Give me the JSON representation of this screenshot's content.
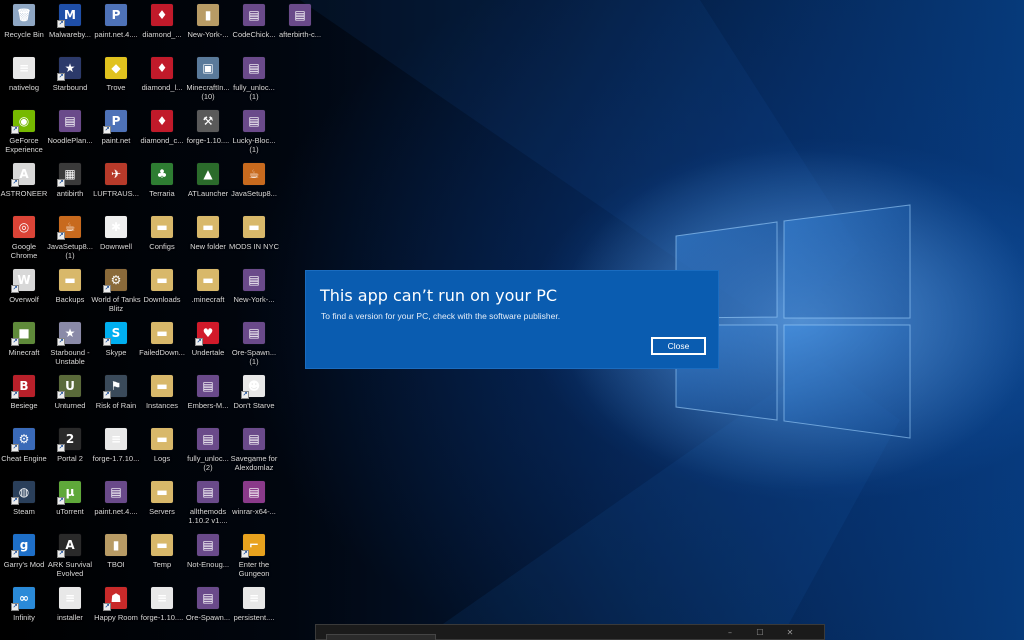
{
  "desktop": {
    "icons": [
      {
        "label": "Recycle Bin",
        "icon": "recycle-bin-icon",
        "color": "#8fa7c4",
        "glyph": "🗑",
        "shortcut": false
      },
      {
        "label": "Malwareby...",
        "icon": "malwarebytes-icon",
        "color": "#1f4fa8",
        "glyph": "M",
        "shortcut": true
      },
      {
        "label": "paint.net.4....",
        "icon": "paintnet-installer-icon",
        "color": "#4e72b8",
        "glyph": "P",
        "shortcut": false
      },
      {
        "label": "diamond_...",
        "icon": "diamond-app-icon",
        "color": "#c11a2a",
        "glyph": "♦",
        "shortcut": false
      },
      {
        "label": "New-York-...",
        "icon": "file-icon",
        "color": "#b89b65",
        "glyph": "▮",
        "shortcut": false
      },
      {
        "label": "CodeChick...",
        "icon": "winrar-archive-icon",
        "color": "#6a4a8a",
        "glyph": "▤",
        "shortcut": false
      },
      {
        "label": "afterbirth-c...",
        "icon": "winrar-archive-icon",
        "color": "#6a4a8a",
        "glyph": "▤",
        "shortcut": false
      },
      {
        "label": "nativelog",
        "icon": "text-file-icon",
        "color": "#e8e8e8",
        "glyph": "≡",
        "shortcut": false
      },
      {
        "label": "Starbound",
        "icon": "starbound-icon",
        "color": "#2c3a6a",
        "glyph": "★",
        "shortcut": true
      },
      {
        "label": "Trove",
        "icon": "trove-icon",
        "color": "#e0c21e",
        "glyph": "◆",
        "shortcut": false
      },
      {
        "label": "diamond_l...",
        "icon": "diamond-app-icon",
        "color": "#c11a2a",
        "glyph": "♦",
        "shortcut": false
      },
      {
        "label": "MinecraftIn... (10)",
        "icon": "minecraft-installer-icon",
        "color": "#5a7a9a",
        "glyph": "▣",
        "shortcut": false
      },
      {
        "label": "fully_unloc... (1)",
        "icon": "winrar-archive-icon",
        "color": "#6a4a8a",
        "glyph": "▤",
        "shortcut": false
      },
      {
        "label": "GeForce Experience",
        "icon": "geforce-icon",
        "color": "#76b900",
        "glyph": "◉",
        "shortcut": true
      },
      {
        "label": "NoodlePlan...",
        "icon": "winrar-archive-icon",
        "color": "#6a4a8a",
        "glyph": "▤",
        "shortcut": false
      },
      {
        "label": "paint.net",
        "icon": "paintnet-icon",
        "color": "#4e72b8",
        "glyph": "P",
        "shortcut": true
      },
      {
        "label": "diamond_c...",
        "icon": "diamond-app-icon",
        "color": "#c11a2a",
        "glyph": "♦",
        "shortcut": false
      },
      {
        "label": "forge-1.10....",
        "icon": "forge-icon",
        "color": "#5a5a5a",
        "glyph": "⚒",
        "shortcut": false
      },
      {
        "label": "Lucky-Bloc... (1)",
        "icon": "winrar-archive-icon",
        "color": "#6a4a8a",
        "glyph": "▤",
        "shortcut": false
      },
      {
        "label": "ASTRONEER",
        "icon": "astroneer-icon",
        "color": "#d8d8d8",
        "glyph": "A",
        "shortcut": true
      },
      {
        "label": "antibirth",
        "icon": "antibirth-icon",
        "color": "#3a3a3a",
        "glyph": "▦",
        "shortcut": true
      },
      {
        "label": "LUFTRAUS...",
        "icon": "luftrausers-icon",
        "color": "#b73a2a",
        "glyph": "✈",
        "shortcut": false
      },
      {
        "label": "Terraria",
        "icon": "terraria-icon",
        "color": "#2e7d32",
        "glyph": "♣",
        "shortcut": false
      },
      {
        "label": "ATLauncher",
        "icon": "atlauncher-icon",
        "color": "#2b6b2b",
        "glyph": "▲",
        "shortcut": false
      },
      {
        "label": "JavaSetup8...",
        "icon": "java-icon",
        "color": "#c86a1e",
        "glyph": "☕",
        "shortcut": false
      },
      {
        "label": "Google Chrome",
        "icon": "chrome-icon",
        "color": "#db4437",
        "glyph": "◎",
        "shortcut": false
      },
      {
        "label": "JavaSetup8... (1)",
        "icon": "java-icon",
        "color": "#c86a1e",
        "glyph": "☕",
        "shortcut": true
      },
      {
        "label": "Downwell",
        "icon": "downwell-icon",
        "color": "#efefef",
        "glyph": "✱",
        "shortcut": false
      },
      {
        "label": "Configs",
        "icon": "folder-icon",
        "color": "#d8b86a",
        "glyph": "▬",
        "shortcut": false
      },
      {
        "label": "New folder",
        "icon": "folder-icon",
        "color": "#d8b86a",
        "glyph": "▬",
        "shortcut": false
      },
      {
        "label": "MODS IN NYC",
        "icon": "folder-icon",
        "color": "#d8b86a",
        "glyph": "▬",
        "shortcut": false
      },
      {
        "label": "Overwolf",
        "icon": "overwolf-icon",
        "color": "#d8d8d8",
        "glyph": "W",
        "shortcut": true
      },
      {
        "label": "Backups",
        "icon": "folder-icon",
        "color": "#d8b86a",
        "glyph": "▬",
        "shortcut": false
      },
      {
        "label": "World of Tanks Blitz",
        "icon": "wot-blitz-icon",
        "color": "#8a6a3a",
        "glyph": "⚙",
        "shortcut": true
      },
      {
        "label": "Downloads",
        "icon": "folder-icon",
        "color": "#d8b86a",
        "glyph": "▬",
        "shortcut": false
      },
      {
        "label": ".minecraft",
        "icon": "folder-icon",
        "color": "#d8b86a",
        "glyph": "▬",
        "shortcut": false
      },
      {
        "label": "New-York-...",
        "icon": "winrar-archive-icon",
        "color": "#6a4a8a",
        "glyph": "▤",
        "shortcut": false
      },
      {
        "label": "Minecraft",
        "icon": "minecraft-icon",
        "color": "#5f8a3a",
        "glyph": "■",
        "shortcut": true
      },
      {
        "label": "Starbound - Unstable",
        "icon": "starbound-icon",
        "color": "#8a8aa8",
        "glyph": "★",
        "shortcut": true
      },
      {
        "label": "Skype",
        "icon": "skype-icon",
        "color": "#00aff0",
        "glyph": "S",
        "shortcut": true
      },
      {
        "label": "FailedDown...",
        "icon": "folder-icon",
        "color": "#d8b86a",
        "glyph": "▬",
        "shortcut": false
      },
      {
        "label": "Undertale",
        "icon": "undertale-icon",
        "color": "#d11a2a",
        "glyph": "♥",
        "shortcut": true
      },
      {
        "label": "Ore-Spawn... (1)",
        "icon": "winrar-archive-icon",
        "color": "#6a4a8a",
        "glyph": "▤",
        "shortcut": false
      },
      {
        "label": "Besiege",
        "icon": "besiege-icon",
        "color": "#b8202a",
        "glyph": "B",
        "shortcut": true
      },
      {
        "label": "Unturned",
        "icon": "unturned-icon",
        "color": "#5a6a3a",
        "glyph": "U",
        "shortcut": true
      },
      {
        "label": "Risk of Rain",
        "icon": "risk-of-rain-icon",
        "color": "#3a4a5a",
        "glyph": "⚑",
        "shortcut": true
      },
      {
        "label": "Instances",
        "icon": "folder-icon",
        "color": "#d8b86a",
        "glyph": "▬",
        "shortcut": false
      },
      {
        "label": "Embers-M...",
        "icon": "winrar-archive-icon",
        "color": "#6a4a8a",
        "glyph": "▤",
        "shortcut": false
      },
      {
        "label": "Don't Starve",
        "icon": "dont-starve-icon",
        "color": "#e8e8e8",
        "glyph": "☻",
        "shortcut": true
      },
      {
        "label": "Cheat Engine",
        "icon": "cheat-engine-icon",
        "color": "#3a6ab8",
        "glyph": "⚙",
        "shortcut": true
      },
      {
        "label": "Portal 2",
        "icon": "portal2-icon",
        "color": "#2a2a2a",
        "glyph": "2",
        "shortcut": true
      },
      {
        "label": "forge-1.7.10...",
        "icon": "text-file-icon",
        "color": "#e8e8e8",
        "glyph": "≡",
        "shortcut": false
      },
      {
        "label": "Logs",
        "icon": "folder-icon",
        "color": "#d8b86a",
        "glyph": "▬",
        "shortcut": false
      },
      {
        "label": "fully_unloc... (2)",
        "icon": "winrar-archive-icon",
        "color": "#6a4a8a",
        "glyph": "▤",
        "shortcut": false
      },
      {
        "label": "Savegame for Alexdomlaz",
        "icon": "winrar-archive-icon",
        "color": "#6a4a8a",
        "glyph": "▤",
        "shortcut": false
      },
      {
        "label": "Steam",
        "icon": "steam-icon",
        "color": "#2a3f5a",
        "glyph": "◍",
        "shortcut": true
      },
      {
        "label": "uTorrent",
        "icon": "utorrent-icon",
        "color": "#5fa83a",
        "glyph": "µ",
        "shortcut": true
      },
      {
        "label": "paint.net.4....",
        "icon": "winrar-archive-icon",
        "color": "#6a4a8a",
        "glyph": "▤",
        "shortcut": false
      },
      {
        "label": "Servers",
        "icon": "folder-icon",
        "color": "#d8b86a",
        "glyph": "▬",
        "shortcut": false
      },
      {
        "label": "allthemods 1.10.2 v1....",
        "icon": "winrar-archive-icon",
        "color": "#6a4a8a",
        "glyph": "▤",
        "shortcut": false
      },
      {
        "label": "winrar-x64-...",
        "icon": "winrar-icon",
        "color": "#8a3a8a",
        "glyph": "▤",
        "shortcut": false
      },
      {
        "label": "Garry's Mod",
        "icon": "garrys-mod-icon",
        "color": "#1e6fc8",
        "glyph": "g",
        "shortcut": true
      },
      {
        "label": "ARK Survival Evolved",
        "icon": "ark-icon",
        "color": "#2a2a2a",
        "glyph": "A",
        "shortcut": true
      },
      {
        "label": "TBOI",
        "icon": "file-icon",
        "color": "#b89b65",
        "glyph": "▮",
        "shortcut": false
      },
      {
        "label": "Temp",
        "icon": "folder-icon",
        "color": "#d8b86a",
        "glyph": "▬",
        "shortcut": false
      },
      {
        "label": "Not-Enoug...",
        "icon": "winrar-archive-icon",
        "color": "#6a4a8a",
        "glyph": "▤",
        "shortcut": false
      },
      {
        "label": "Enter the Gungeon",
        "icon": "enter-the-gungeon-icon",
        "color": "#e8a21e",
        "glyph": "⌐",
        "shortcut": true
      },
      {
        "label": "Infinity",
        "icon": "infinity-icon",
        "color": "#2a8ad8",
        "glyph": "∞",
        "shortcut": true
      },
      {
        "label": "installer",
        "icon": "text-file-icon",
        "color": "#e8e8e8",
        "glyph": "≡",
        "shortcut": false
      },
      {
        "label": "Happy Room",
        "icon": "happy-room-icon",
        "color": "#c82a2a",
        "glyph": "☗",
        "shortcut": true
      },
      {
        "label": "forge-1.10....",
        "icon": "text-file-icon",
        "color": "#e8e8e8",
        "glyph": "≡",
        "shortcut": false
      },
      {
        "label": "Ore-Spawn...",
        "icon": "winrar-archive-icon",
        "color": "#6a4a8a",
        "glyph": "▤",
        "shortcut": false
      },
      {
        "label": "persistent....",
        "icon": "text-file-icon",
        "color": "#e8e8e8",
        "glyph": "≡",
        "shortcut": false
      }
    ]
  },
  "dialog": {
    "title": "This app can’t run on your PC",
    "message": "To find a version for your PC, check with the software publisher.",
    "close_label": "Close",
    "accent": "#0a5cb0"
  },
  "background_window": {
    "controls": [
      "–",
      "☐",
      "✕"
    ]
  }
}
